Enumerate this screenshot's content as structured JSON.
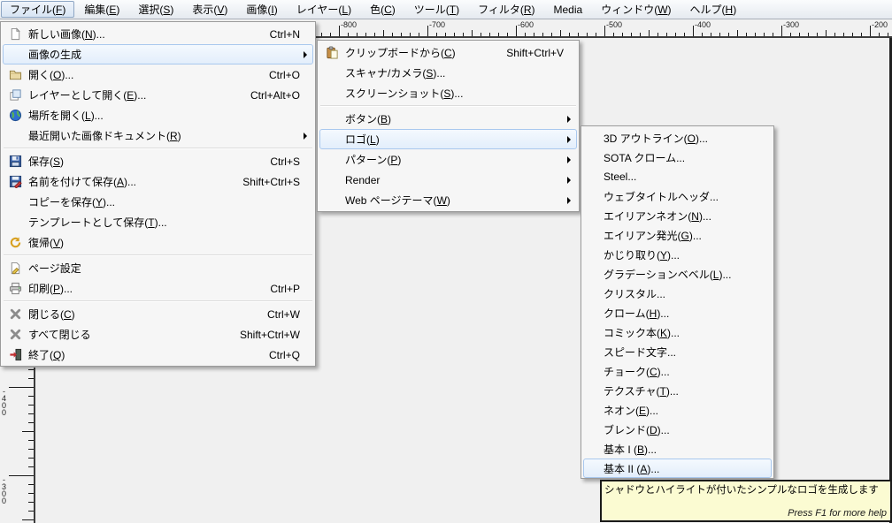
{
  "menubar": {
    "items": [
      {
        "label": "ファイル(F)",
        "selected": true
      },
      {
        "label": "編集(E)"
      },
      {
        "label": "選択(S)"
      },
      {
        "label": "表示(V)"
      },
      {
        "label": "画像(I)"
      },
      {
        "label": "レイヤー(L)"
      },
      {
        "label": "色(C)"
      },
      {
        "label": "ツール(T)"
      },
      {
        "label": "フィルタ(R)"
      },
      {
        "label": "Media"
      },
      {
        "label": "ウィンドウ(W)"
      },
      {
        "label": "ヘルプ(H)"
      }
    ]
  },
  "file_menu": {
    "items": [
      {
        "icon": "new-image-icon",
        "label": "新しい画像(N)...",
        "shortcut": "Ctrl+N"
      },
      {
        "label": "画像の生成",
        "submenu": true,
        "highlighted": true
      },
      {
        "icon": "open-folder-icon",
        "label": "開く(O)...",
        "shortcut": "Ctrl+O"
      },
      {
        "icon": "open-as-layer-icon",
        "label": "レイヤーとして開く(E)...",
        "shortcut": "Ctrl+Alt+O"
      },
      {
        "icon": "globe-icon",
        "label": "場所を開く(L)..."
      },
      {
        "label": "最近開いた画像ドキュメント(R)",
        "submenu": true
      },
      {
        "type": "separator"
      },
      {
        "icon": "save-icon",
        "label": "保存(S)",
        "shortcut": "Ctrl+S"
      },
      {
        "icon": "save-as-icon",
        "label": "名前を付けて保存(A)...",
        "shortcut": "Shift+Ctrl+S"
      },
      {
        "label": "コピーを保存(Y)..."
      },
      {
        "label": "テンプレートとして保存(T)..."
      },
      {
        "icon": "revert-icon",
        "label": "復帰(V)"
      },
      {
        "type": "separator"
      },
      {
        "icon": "page-setup-icon",
        "label": "ページ設定"
      },
      {
        "icon": "printer-icon",
        "label": "印刷(P)...",
        "shortcut": "Ctrl+P"
      },
      {
        "type": "separator"
      },
      {
        "icon": "close-icon",
        "label": "閉じる(C)",
        "shortcut": "Ctrl+W"
      },
      {
        "icon": "close-all-icon",
        "label": "すべて閉じる",
        "shortcut": "Shift+Ctrl+W"
      },
      {
        "icon": "quit-icon",
        "label": "終了(Q)",
        "shortcut": "Ctrl+Q"
      }
    ]
  },
  "create_menu": {
    "items": [
      {
        "icon": "paste-icon",
        "label": "クリップボードから(C)",
        "shortcut": "Shift+Ctrl+V"
      },
      {
        "label": "スキャナ/カメラ(S)..."
      },
      {
        "label": "スクリーンショット(S)..."
      },
      {
        "type": "separator"
      },
      {
        "label": "ボタン(B)",
        "submenu": true
      },
      {
        "label": "ロゴ(L)",
        "submenu": true,
        "highlighted": true
      },
      {
        "label": "パターン(P)",
        "submenu": true
      },
      {
        "label": "Render",
        "submenu": true
      },
      {
        "label": "Web ページテーマ(W)",
        "submenu": true
      }
    ]
  },
  "logo_menu": {
    "items": [
      {
        "label": "3D アウトライン(O)..."
      },
      {
        "label": "SOTA クローム..."
      },
      {
        "label": "Steel..."
      },
      {
        "label": "ウェブタイトルヘッダ..."
      },
      {
        "label": "エイリアンネオン(N)..."
      },
      {
        "label": "エイリアン発光(G)..."
      },
      {
        "label": "かじり取り(Y)..."
      },
      {
        "label": "グラデーションベベル(L)..."
      },
      {
        "label": "クリスタル..."
      },
      {
        "label": "クローム(H)..."
      },
      {
        "label": "コミック本(K)..."
      },
      {
        "label": "スピード文字..."
      },
      {
        "label": "チョーク(C)..."
      },
      {
        "label": "テクスチャ(T)..."
      },
      {
        "label": "ネオン(E)..."
      },
      {
        "label": "ブレンド(D)..."
      },
      {
        "label": "基本 I (B)..."
      },
      {
        "label": "基本 II (A)...",
        "highlighted": true
      }
    ]
  },
  "tooltip": {
    "text": "シャドウとハイライトが付いたシンプルなロゴを生成します",
    "help": "Press F1 for more help"
  },
  "rulers": {
    "horizontal_labels": [
      "-800",
      "-700",
      "-600",
      "-500",
      "-400",
      "-300",
      "-200"
    ],
    "vertical_labels": [
      "-400",
      "-300"
    ]
  },
  "colors": {
    "menu_highlight_bg": "#f4f9fe",
    "menu_highlight_border": "#a9c8ee",
    "selected_item_border": "#8ea6c4",
    "tooltip_bg": "#fbfbd2",
    "ruler_bg": "#f1f1f1"
  }
}
